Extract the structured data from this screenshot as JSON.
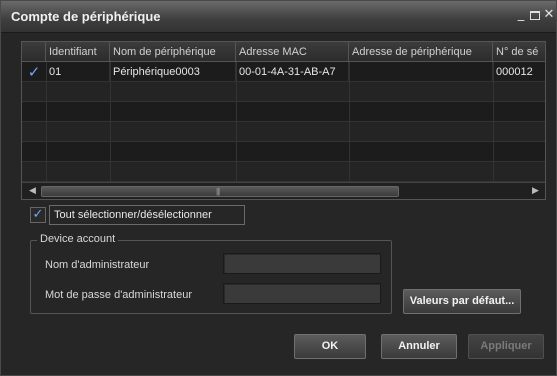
{
  "window": {
    "title": "Compte de périphérique",
    "minimize_label": "_",
    "close_label": "✕"
  },
  "table": {
    "headers": [
      "Identifiant",
      "Nom de périphérique",
      "Adresse MAC",
      "Adresse de périphérique",
      "N° de sé"
    ],
    "rows": [
      {
        "checked": true,
        "check_glyph": "✓",
        "id": "01",
        "name": "Périphérique0003",
        "mac": "00-01-4A-31-AB-A7",
        "address": "",
        "serial": "000012"
      }
    ],
    "scroll_grip": "|||",
    "scroll_left": "◀",
    "scroll_right": "▶"
  },
  "select_all": {
    "checked": true,
    "check_glyph": "✓",
    "label": "Tout sélectionner/désélectionner"
  },
  "device_account": {
    "title": "Device account",
    "admin_name_label": "Nom d'administrateur",
    "admin_name_value": "",
    "admin_password_label": "Mot de passe d'administrateur",
    "admin_password_value": ""
  },
  "buttons": {
    "defaults": "Valeurs par défaut...",
    "ok": "OK",
    "cancel": "Annuler",
    "apply": "Appliquer"
  },
  "colors": {
    "accent_check": "#6fa8ff",
    "background": "#262626"
  }
}
